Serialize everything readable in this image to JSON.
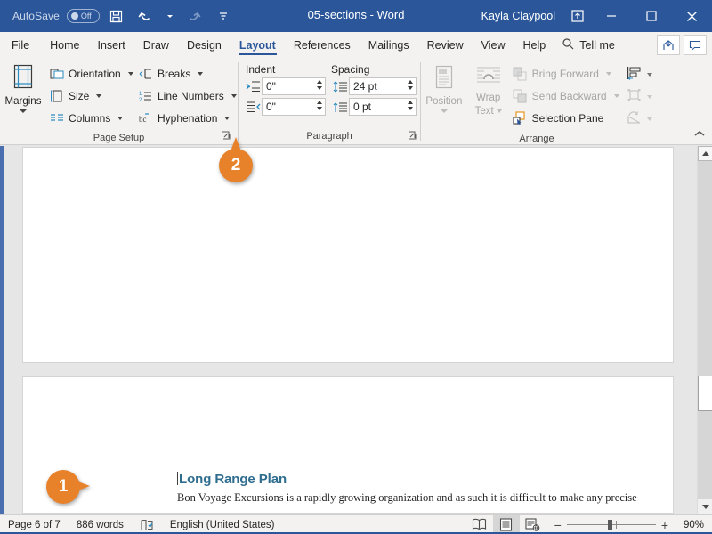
{
  "titlebar": {
    "autosave_label": "AutoSave",
    "autosave_state": "Off",
    "save_icon": "save-icon",
    "undo_icon": "undo-icon",
    "redo_icon": "redo-icon",
    "customize_icon": "customize-quick-access-icon",
    "document_title": "05-sections - Word",
    "user_name": "Kayla Claypool",
    "restore_ribbon_icon": "ribbon-display-options-icon",
    "minimize_icon": "minimize-icon",
    "maximize_icon": "maximize-icon",
    "close_icon": "close-icon",
    "bg_color": "#2b579a"
  },
  "tabs": [
    {
      "label": "File",
      "active": false
    },
    {
      "label": "Home",
      "active": false
    },
    {
      "label": "Insert",
      "active": false
    },
    {
      "label": "Draw",
      "active": false
    },
    {
      "label": "Design",
      "active": false
    },
    {
      "label": "Layout",
      "active": true
    },
    {
      "label": "References",
      "active": false
    },
    {
      "label": "Mailings",
      "active": false
    },
    {
      "label": "Review",
      "active": false
    },
    {
      "label": "View",
      "active": false
    },
    {
      "label": "Help",
      "active": false
    }
  ],
  "tellme": {
    "label": "Tell me",
    "icon": "search-icon"
  },
  "tab_right": {
    "share_icon": "share-icon",
    "comments_icon": "comments-icon"
  },
  "ribbon": {
    "collapse_icon": "collapse-ribbon-caret-icon",
    "groups": [
      {
        "label": "Page Setup",
        "dialog_launcher": "page-setup-dialog-launcher",
        "big_button": {
          "label": "Margins",
          "icon": "margins-icon",
          "has_dropdown": true
        },
        "items_col1": [
          {
            "label": "Orientation",
            "icon": "orientation-icon",
            "dropdown": true,
            "disabled": false
          },
          {
            "label": "Size",
            "icon": "size-icon",
            "dropdown": true,
            "disabled": false
          },
          {
            "label": "Columns",
            "icon": "columns-icon",
            "dropdown": true,
            "disabled": false
          }
        ],
        "items_col2": [
          {
            "label": "Breaks",
            "icon": "breaks-icon",
            "dropdown": true,
            "disabled": false
          },
          {
            "label": "Line Numbers",
            "icon": "line-numbers-icon",
            "dropdown": true,
            "disabled": false
          },
          {
            "label": "Hyphenation",
            "icon": "hyphenation-icon",
            "dropdown": true,
            "disabled": false
          }
        ]
      },
      {
        "label": "Paragraph",
        "dialog_launcher": "paragraph-dialog-launcher",
        "heading_indent": "Indent",
        "heading_spacing": "Spacing",
        "indent_left": {
          "value": "0\"",
          "icon": "indent-left-icon"
        },
        "indent_right": {
          "value": "0\"",
          "icon": "indent-right-icon"
        },
        "spacing_before": {
          "value": "24 pt",
          "icon": "spacing-before-icon"
        },
        "spacing_after": {
          "value": "0 pt",
          "icon": "spacing-after-icon"
        }
      },
      {
        "label": "Arrange",
        "big_buttons": [
          {
            "label": "Position",
            "icon": "position-icon",
            "has_dropdown": true,
            "disabled": true
          },
          {
            "label": "Wrap\nText",
            "icon": "wrap-text-icon",
            "has_dropdown": true,
            "disabled": true
          }
        ],
        "wrap_text_line1": "Wrap",
        "wrap_text_line2": "Text",
        "items": [
          {
            "label": "Bring Forward",
            "icon": "bring-forward-icon",
            "dropdown": true,
            "disabled": true
          },
          {
            "label": "Send Backward",
            "icon": "send-backward-icon",
            "dropdown": true,
            "disabled": true
          },
          {
            "label": "Selection Pane",
            "icon": "selection-pane-icon",
            "dropdown": false,
            "disabled": false
          }
        ],
        "icon_items": [
          {
            "icon": "align-objects-icon",
            "dropdown": true,
            "disabled": false
          },
          {
            "icon": "group-objects-icon",
            "dropdown": true,
            "disabled": true
          },
          {
            "icon": "rotate-objects-icon",
            "dropdown": true,
            "disabled": true
          }
        ]
      }
    ]
  },
  "document": {
    "heading": "Long Range Plan",
    "heading_color": "#2e6d8e",
    "body": "Bon Voyage Excursions is a rapidly growing organization and as such it is difficult to make any precise"
  },
  "scrollbar": {
    "up_icon": "scroll-up-icon",
    "down_icon": "scroll-down-icon",
    "thumb": "vertical-scroll-thumb"
  },
  "statusbar": {
    "page_label": "Page 6 of 7",
    "word_count": "886 words",
    "proofing_icon": "proofing-errors-icon",
    "language": "English (United States)",
    "views": [
      {
        "icon": "read-mode-icon",
        "selected": false
      },
      {
        "icon": "print-layout-icon",
        "selected": true
      },
      {
        "icon": "web-layout-icon",
        "selected": false
      }
    ],
    "zoom_out_label": "−",
    "zoom_in_label": "+",
    "zoom_level": "90%"
  },
  "callouts": [
    {
      "number": "1",
      "color": "#e8822a",
      "direction": "right",
      "target": "document-heading"
    },
    {
      "number": "2",
      "color": "#e8822a",
      "direction": "up",
      "target": "page-setup-dialog-launcher"
    }
  ]
}
